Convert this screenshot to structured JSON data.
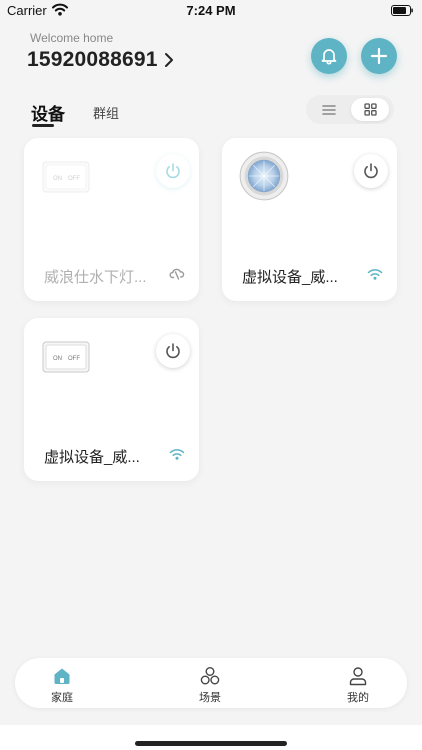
{
  "status_bar": {
    "carrier": "Carrier",
    "time": "7:24 PM"
  },
  "header": {
    "welcome": "Welcome home",
    "phone": "15920088691",
    "bell_icon": "bell-icon",
    "add_icon": "plus-icon"
  },
  "tabs": [
    {
      "label": "设备",
      "active": true
    },
    {
      "label": "群组",
      "active": false
    }
  ],
  "view_toggle": {
    "options": [
      "list",
      "grid"
    ],
    "selected": "grid"
  },
  "devices": [
    {
      "name": "威浪仕水下灯...",
      "status": "offline",
      "thumbnail": "switch-thumbnail",
      "network_icon": "cloud-offline-icon"
    },
    {
      "name": "虚拟设备_威...",
      "status": "online",
      "thumbnail": "lamp-thumbnail",
      "network_icon": "wifi-icon"
    },
    {
      "name": "虚拟设备_威...",
      "status": "online",
      "thumbnail": "switch-thumbnail",
      "network_icon": "wifi-icon"
    }
  ],
  "switch_thumbnail_text": {
    "on": "ON",
    "off": "OFF"
  },
  "bottom_nav": [
    {
      "label": "家庭",
      "icon": "home-icon",
      "active": true
    },
    {
      "label": "场景",
      "icon": "scene-icon",
      "active": false
    },
    {
      "label": "我的",
      "icon": "user-icon",
      "active": false
    }
  ],
  "colors": {
    "accent": "#5eb3c4",
    "background": "#f4f4f4",
    "offline_text": "#b0b0b0"
  }
}
